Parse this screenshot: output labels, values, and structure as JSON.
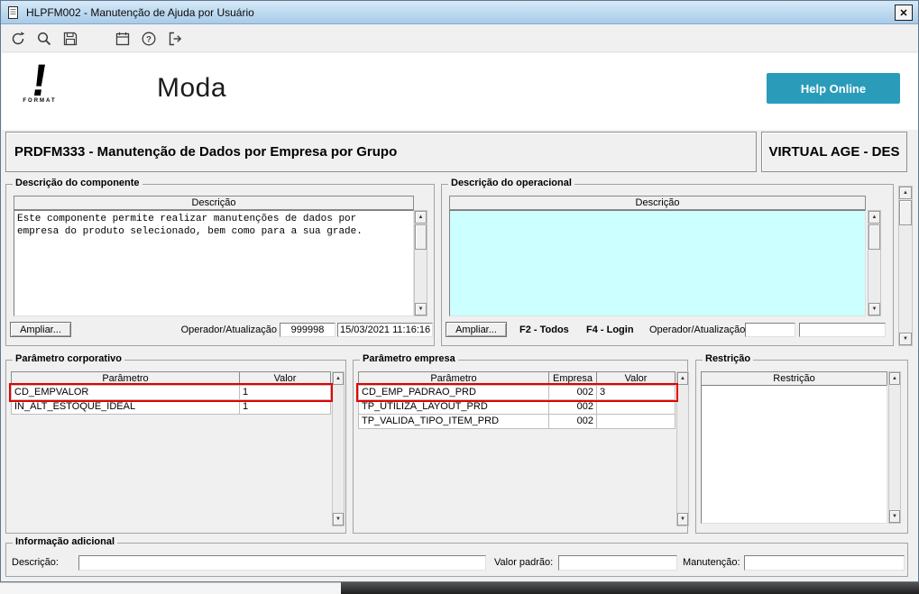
{
  "window": {
    "title": "HLPFM002 - Manutenção de Ajuda por Usuário"
  },
  "toolbar": {
    "buttons": [
      "undo",
      "search",
      "save",
      "calendar",
      "help",
      "exit"
    ]
  },
  "header": {
    "logo_text": "FORMAT",
    "app_name": "Moda",
    "help_button": "Help Online"
  },
  "band": {
    "program": "PRDFM333 - Manutenção de Dados por Empresa por Grupo",
    "environment": "VIRTUAL AGE - DES"
  },
  "componente": {
    "legend": "Descrição do componente",
    "column": "Descrição",
    "text": "Este componente permite realizar manutenções de dados por empresa do produto selecionado, bem como para a sua grade.",
    "ampliar_label": "Ampliar...",
    "operador_label": "Operador/Atualização",
    "operador_value": "999998",
    "atualizacao_value": "15/03/2021 11:16:16"
  },
  "operacional": {
    "legend": "Descrição do operacional",
    "column": "Descrição",
    "ampliar_label": "Ampliar...",
    "f2_label": "F2 - Todos",
    "f4_label": "F4 - Login",
    "operador_label": "Operador/Atualização",
    "operador_value": "",
    "atualizacao_value": ""
  },
  "corporativo": {
    "legend": "Parâmetro corporativo",
    "columns": [
      "Parâmetro",
      "Valor"
    ],
    "rows": [
      {
        "parametro": "CD_EMPVALOR",
        "valor": "1"
      },
      {
        "parametro": "IN_ALT_ESTOQUE_IDEAL",
        "valor": "1"
      }
    ]
  },
  "empresa": {
    "legend": "Parâmetro empresa",
    "columns": [
      "Parâmetro",
      "Empresa",
      "Valor"
    ],
    "rows": [
      {
        "parametro": "CD_EMP_PADRAO_PRD",
        "empresa": "002",
        "valor": "3"
      },
      {
        "parametro": "TP_UTILIZA_LAYOUT_PRD",
        "empresa": "002",
        "valor": ""
      },
      {
        "parametro": "TP_VALIDA_TIPO_ITEM_PRD",
        "empresa": "002",
        "valor": ""
      }
    ]
  },
  "restricao": {
    "legend": "Restrição",
    "column": "Restrição"
  },
  "info": {
    "legend": "Informação adicional",
    "descricao_label": "Descrição:",
    "descricao_value": "",
    "valor_padrao_label": "Valor padrão:",
    "valor_padrao_value": "",
    "manutencao_label": "Manutenção:",
    "manutencao_value": ""
  },
  "icons": {
    "up": "▲",
    "down": "▼",
    "close": "✕"
  },
  "colors": {
    "titlebar": "#b9d6f0",
    "help_button": "#2a9cba",
    "highlight_red": "#e60000",
    "operational_bg": "#ccffff"
  }
}
